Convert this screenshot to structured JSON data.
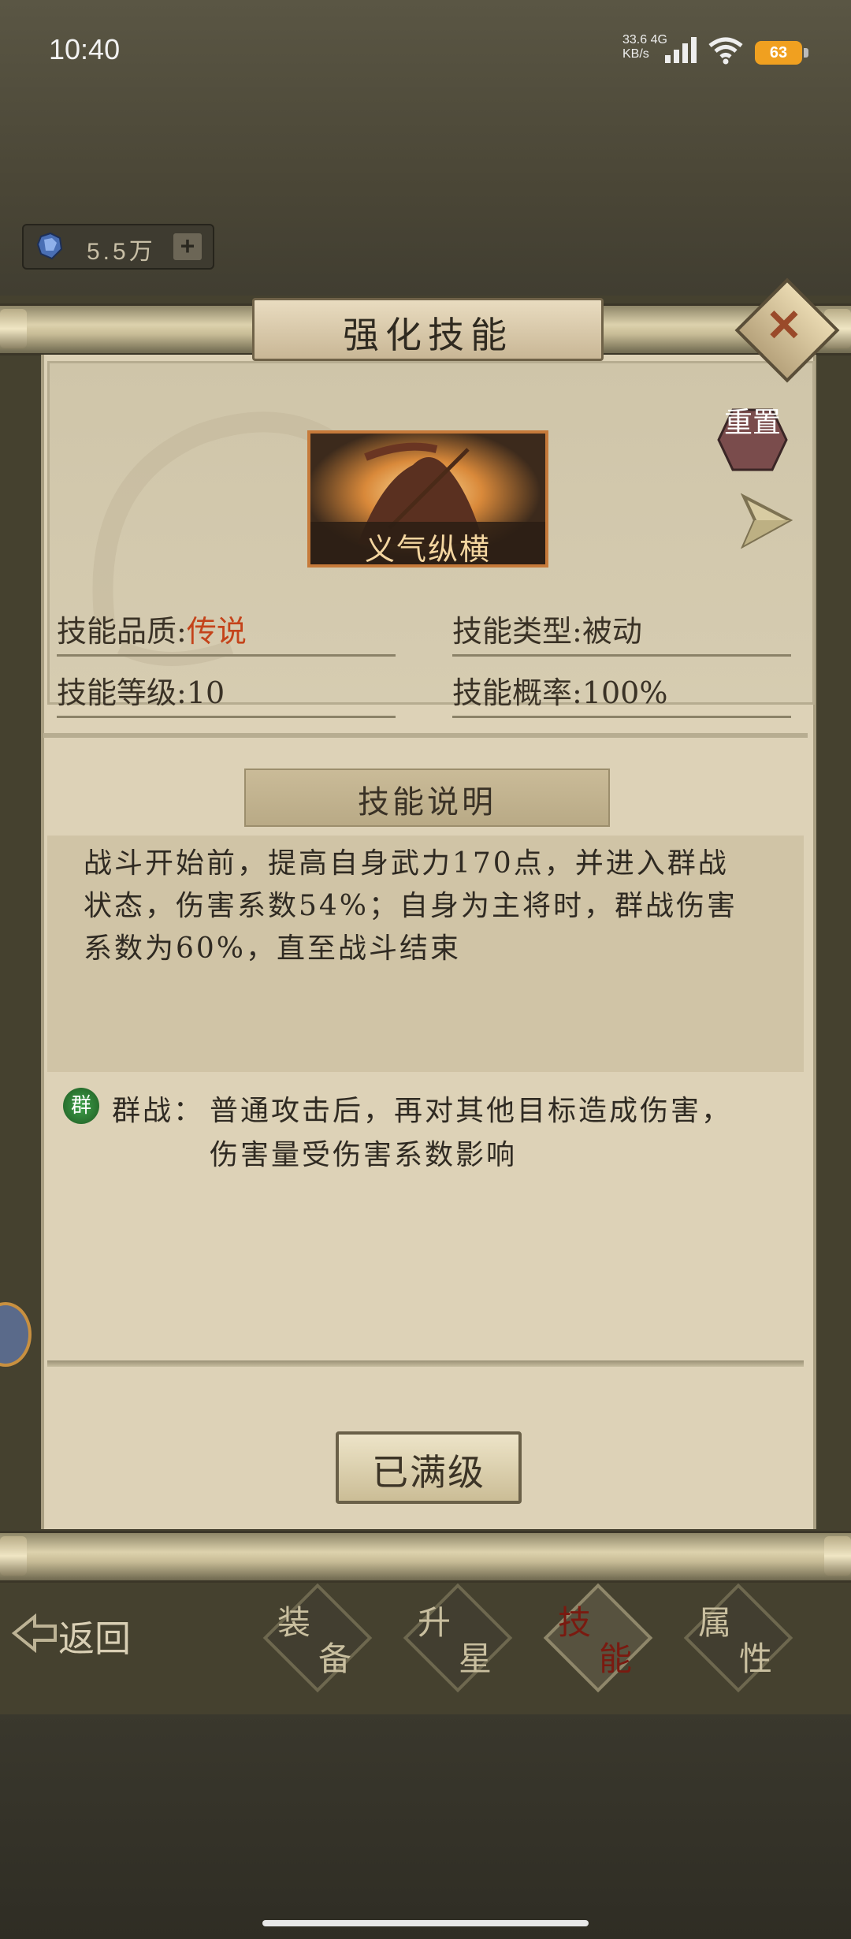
{
  "status_bar": {
    "time": "10:40",
    "net_speed_value": "33.6",
    "net_speed_unit": "KB/s",
    "network_type": "4G",
    "battery": "63"
  },
  "currency": {
    "icon": "gem-icon",
    "amount": "5.5万",
    "add_label": "+"
  },
  "dialog": {
    "title": "强化技能",
    "close_label": "✕",
    "reset_label": "重置",
    "skill_card": {
      "name": "义气纵横"
    },
    "attributes": {
      "quality_label": "技能品质:",
      "quality_value": "传说",
      "type_label": "技能类型:",
      "type_value": "被动",
      "level_label": "技能等级:",
      "level_value": "10",
      "chance_label": "技能概率:",
      "chance_value": "100%"
    },
    "description_header": "技能说明",
    "description_lines": [
      "战斗开始前，提高自身武力170点，并进入群战",
      "状态，伤害系数54%；自身为主将时，群战伤害",
      "系数为60%，直至战斗结束"
    ],
    "note": {
      "badge": "群",
      "label": "群战：",
      "line1": "普通攻击后，再对其他目标造成伤害，",
      "line2": "伤害量受伤害系数影响"
    },
    "maxed_label": "已满级"
  },
  "nav": {
    "back_label": "返回",
    "tabs": [
      {
        "c1": "装",
        "c2": "备"
      },
      {
        "c1": "升",
        "c2": "星"
      },
      {
        "c1": "技",
        "c2": "能"
      },
      {
        "c1": "属",
        "c2": "性"
      }
    ],
    "active_tab": 2
  },
  "colors": {
    "legend_quality": "#c4431a",
    "active_tab_text": "#7a1a10",
    "group_badge": "#2e7d32"
  }
}
